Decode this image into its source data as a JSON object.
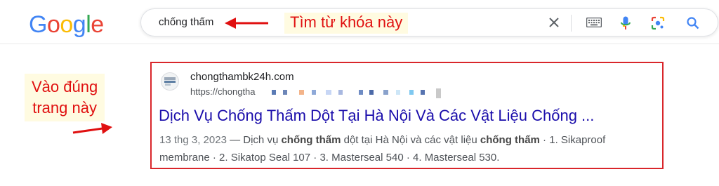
{
  "logo": {
    "letters": [
      "G",
      "o",
      "o",
      "g",
      "l",
      "e"
    ],
    "colors": [
      "#4285f4",
      "#ea4335",
      "#fbbc05",
      "#4285f4",
      "#34a853",
      "#ea4335"
    ]
  },
  "search": {
    "query": "chống thấm"
  },
  "toolbar_icons": [
    "clear-icon",
    "keyboard-icon",
    "microphone-icon",
    "lens-icon",
    "search-icon"
  ],
  "annotations": {
    "search_hint": "Tìm từ khóa này",
    "result_hint_line1": "Vào đúng",
    "result_hint_line2": "trang này",
    "color": "#e01010"
  },
  "result": {
    "site_name": "chongthambk24h.com",
    "url": "https://chongtha",
    "title": "Dịch Vụ Chống Thấm Dột Tại Hà Nội Và Các Vật Liệu Chống ...",
    "date": "13 thg 3, 2023",
    "snippet_parts": [
      "Dịch vụ ",
      "chống thấm",
      " dột tại Hà Nội và các vật liệu ",
      "chống thấm",
      " · 1. Sikaproof membrane · 2. Sikatop Seal 107 · 3. Masterseal 540 · 4. Masterseal 530."
    ],
    "link_color": "#1a0dab"
  }
}
